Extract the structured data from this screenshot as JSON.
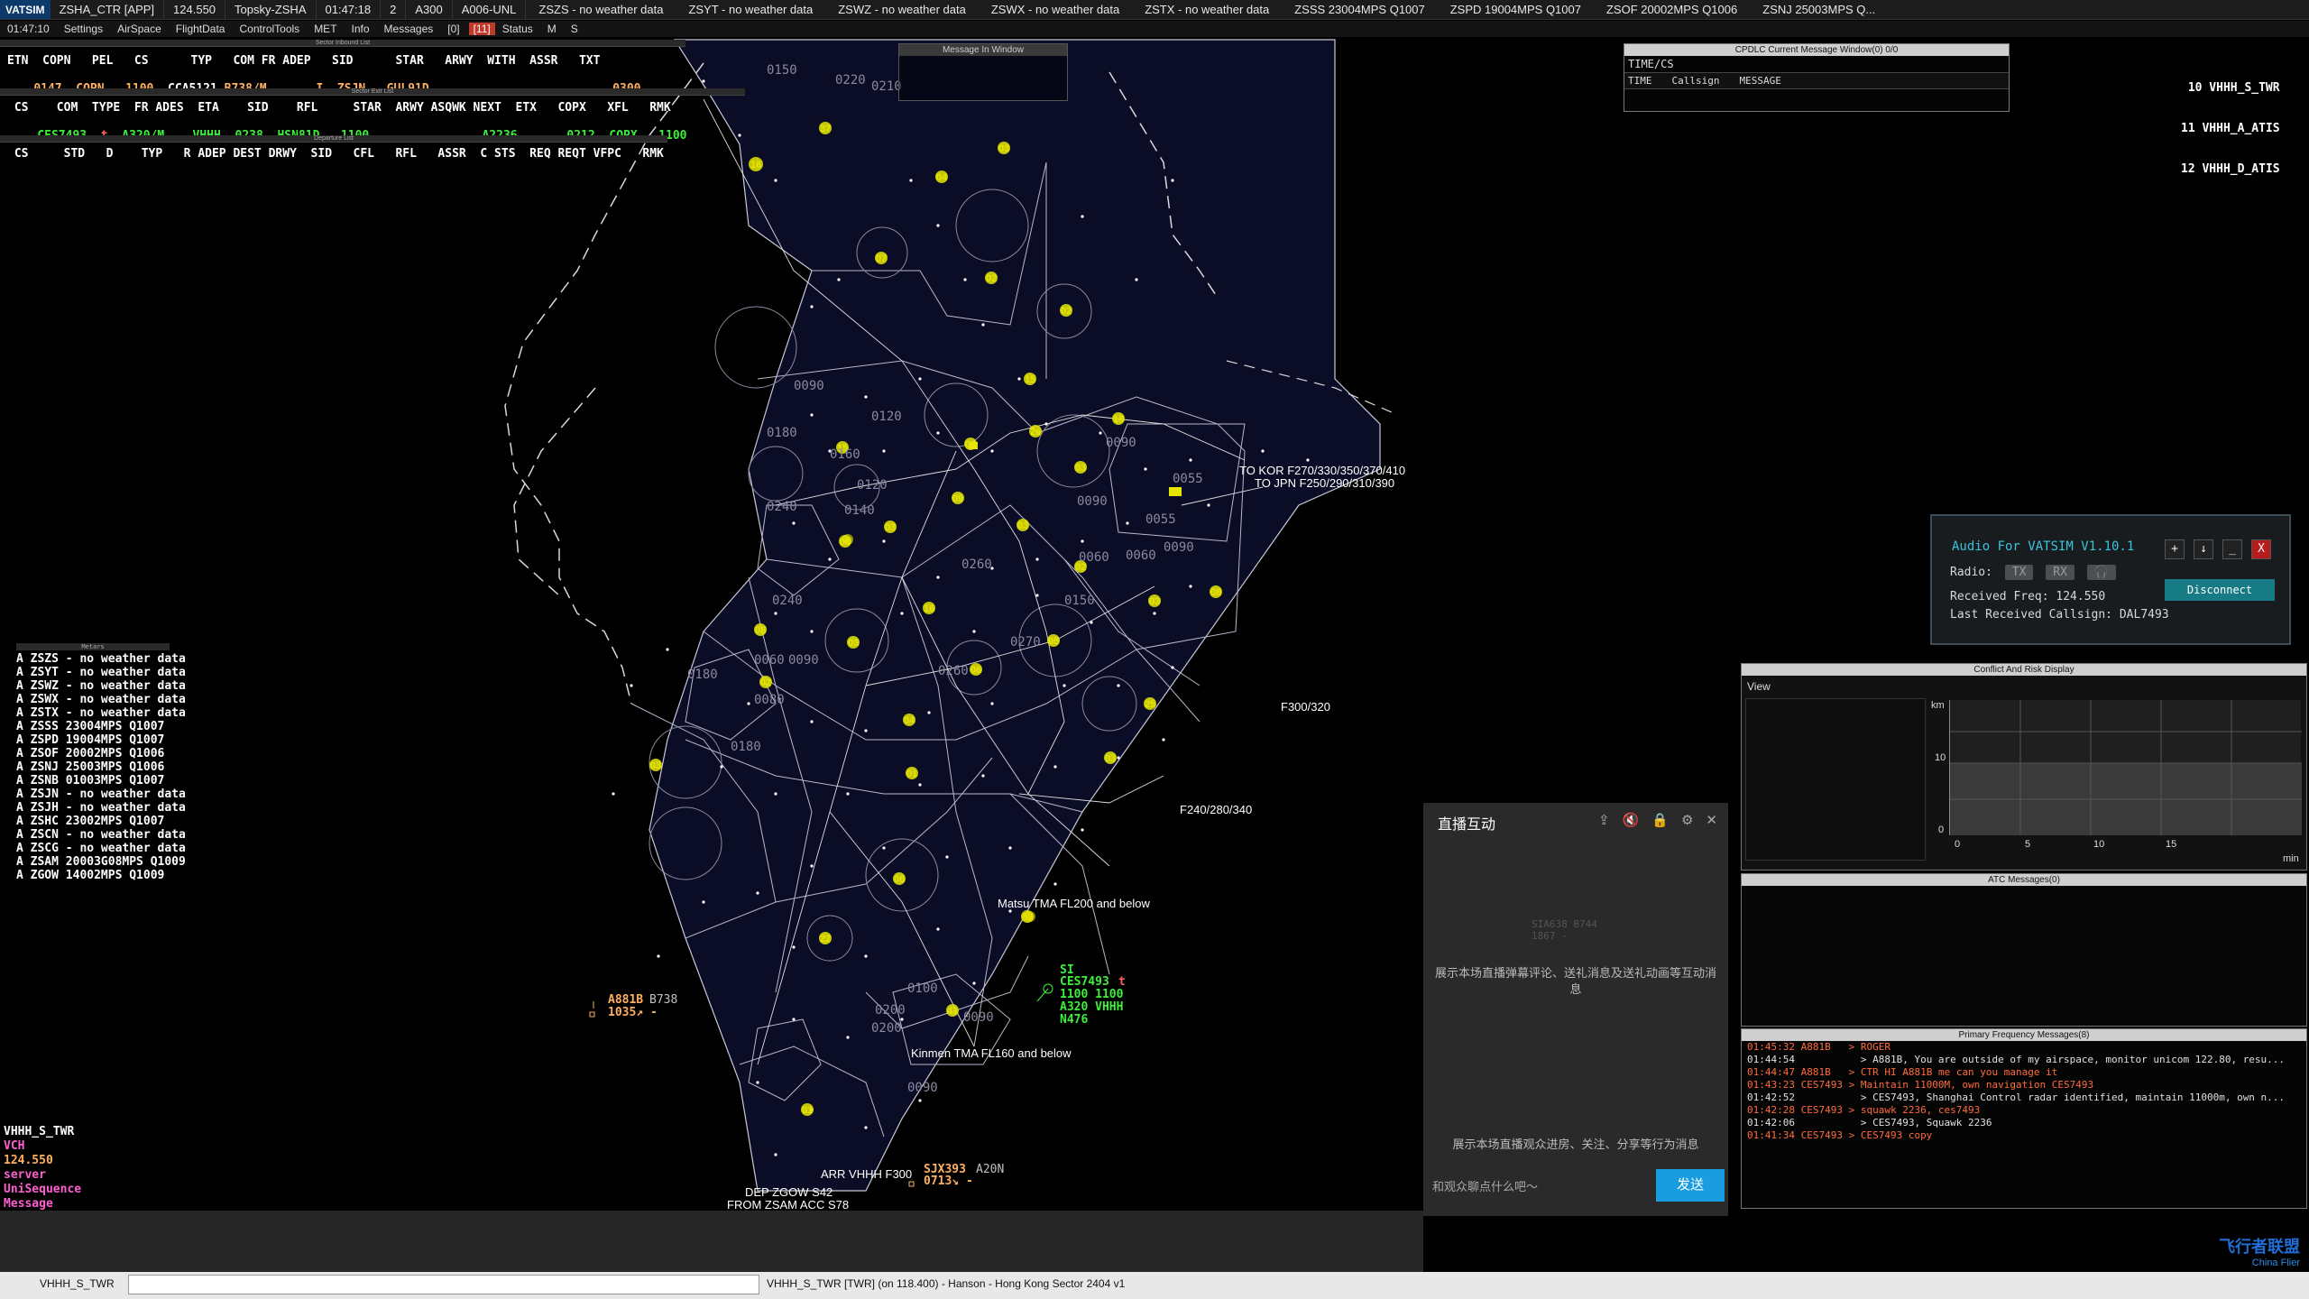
{
  "topbar": {
    "logo": "VATSIM",
    "position": "ZSHA_CTR [APP]",
    "frequency": "124.550",
    "open_sct": "Topsky-ZSHA",
    "time": "01:47:18",
    "min_count": "2",
    "aircraft": "A300",
    "alt_range": "A006-UNL",
    "weather": [
      "ZSZS - no weather data",
      "ZSYT - no weather data",
      "ZSWZ - no weather data",
      "ZSWX - no weather data",
      "ZSTX - no weather data",
      "ZSSS 23004MPS Q1007",
      "ZSPD 19004MPS Q1007",
      "ZSOF 20002MPS Q1006",
      "ZSNJ 25003MPS Q..."
    ]
  },
  "menubar": {
    "time": "01:47:10",
    "items": [
      "Settings",
      "AirSpace",
      "FlightData",
      "ControlTools",
      "MET",
      "Info",
      "Messages"
    ],
    "messages_count": "[0]",
    "warn": "[11]",
    "status": "Status",
    "m": "M",
    "s": "S"
  },
  "sector_inbound": {
    "title": "Sector Inbound List",
    "header": "ETN  COPN   PEL   CS      TYP   COM FR ADEP   SID      STAR   ARWY  WITH  ASSR   TXT",
    "rows": [
      {
        "etn": "0147",
        "copn": "COPN",
        "pel": "1100",
        "cs": "CCA5121",
        "typ": "B738/M",
        "fr": "I",
        "adep": "ZSJN",
        "sid": "GUL91D",
        "eta": "0300"
      }
    ]
  },
  "sector_exit": {
    "title": "Sector Exit List",
    "header": " CS    COM  TYPE  FR ADES  ETA    SID    RFL     STAR  ARWY ASQWK NEXT  ETX   COPX   XFL   RMK",
    "rows": [
      {
        "cs": "CES7493",
        "com": "t",
        "type": "A320/M",
        "ades": "VHHH",
        "eta": "0238",
        "sid": "HSN81D",
        "rfl": "1100",
        "asqwk": "A2236",
        "etx": "0212",
        "copx": "COPX",
        "xfl": "1100"
      }
    ]
  },
  "departure_list": {
    "title": "Departure List",
    "header": " CS     STD   D    TYP   R ADEP DEST DRWY  SID   CFL   RFL   ASSR  C STS  REQ REQT VFPC   RMK"
  },
  "metars": {
    "title": "Metars",
    "rows": [
      "A ZSZS - no weather data",
      "A ZSYT - no weather data",
      "A ZSWZ - no weather data",
      "A ZSWX - no weather data",
      "A ZSTX - no weather data",
      "A ZSSS 23004MPS Q1007",
      "A ZSPD 19004MPS Q1007",
      "A ZSOF 20002MPS Q1006",
      "A ZSNJ 25003MPS Q1006",
      "A ZSNB 01003MPS Q1007",
      "A ZSJN - no weather data",
      "A ZSJH - no weather data",
      "A ZSHC 23002MPS Q1007",
      "A ZSCN - no weather data",
      "A ZSCG - no weather data",
      "A ZSAM 20003G08MPS Q1009",
      "A ZGOW 14002MPS Q1009"
    ]
  },
  "lower_left": {
    "station": "VHHH_S_TWR",
    "vch": "VCH",
    "freq": "124.550",
    "server": "server",
    "unisequence": "UniSequence",
    "message": "Message"
  },
  "message_window": {
    "title": "Message In Window"
  },
  "cpdlc": {
    "title": "CPDLC Current Message Window(0) 0/0",
    "sub": "TIME/CS",
    "cols": [
      "TIME",
      "Callsign",
      "MESSAGE"
    ]
  },
  "atis": {
    "rows": [
      "10 VHHH_S_TWR",
      "11 VHHH_A_ATIS",
      "12 VHHH_D_ATIS"
    ]
  },
  "map": {
    "altitude_labels": [
      "0150",
      "0220",
      "0210",
      "0090",
      "0120",
      "0180",
      "0160",
      "0090",
      "0140",
      "0120",
      "0240",
      "0260",
      "0150",
      "0090",
      "0055",
      "0090",
      "0055",
      "0060",
      "0060",
      "0240",
      "0260",
      "0180",
      "0090",
      "0080",
      "0060",
      "0180",
      "0200",
      "0090",
      "0090",
      "0100",
      "0200",
      "0270"
    ],
    "route_labels": [
      "TO KOR F270/330/350/370/410",
      "TO JPN F250/290/310/390",
      "F300/320",
      "F240/280/340",
      "Matsu TMA FL200 and below",
      "Kinmen TMA FL160 and below",
      "ARR VHHH F300",
      "DEP ZGOW S42",
      "FROM ZSAM ACC S78"
    ],
    "fixes": [
      "16",
      "37",
      "03",
      "07",
      "02",
      "02",
      "04",
      "15",
      "18",
      "26",
      "06",
      "15",
      "03",
      "09",
      "03",
      "03",
      "08",
      "06",
      "02",
      "03",
      "16",
      "08",
      "03",
      "05",
      "06",
      "02",
      "25",
      "04",
      "03",
      "03",
      "01",
      "06",
      "03",
      "22",
      "01",
      "41",
      "03"
    ],
    "tags": [
      {
        "cs": "A881B",
        "type": "B738",
        "alt": "1035↗ -"
      },
      {
        "cs": "CES7493",
        "code": "t",
        "line2": "1100 1100",
        "line3": "A320 VHHH",
        "line4": "N476",
        "label": "SI"
      },
      {
        "cs": "SJX393",
        "type": "A20N",
        "alt": "0713↘ -"
      }
    ],
    "faint_tag": [
      "SIA638 B744",
      "1867 -"
    ]
  },
  "audio": {
    "title": "Audio For VATSIM V1.10.1",
    "radio_label": "Radio:",
    "tx": "TX",
    "rx": "RX",
    "headset_icon": "headset-icon",
    "received_freq": "Received Freq: 124.550",
    "last_callsign": "Last Received Callsign: DAL7493",
    "disconnect": "Disconnect",
    "btn_plus": "+",
    "btn_down": "↓",
    "btn_min": "_",
    "btn_close": "X"
  },
  "conflict": {
    "title": "Conflict And Risk Display",
    "view": "View",
    "y_unit": "km",
    "y_ticks": [
      "10",
      "0"
    ],
    "x_ticks": [
      "0",
      "5",
      "10",
      "15"
    ],
    "x_unit": "min"
  },
  "atc_messages": {
    "title": "ATC Messages(0)"
  },
  "primary_freq": {
    "title": "Primary Frequency Messages(8)",
    "rows": [
      {
        "time": "01:45:32",
        "cs": "A881B",
        "msg": "> ROGER",
        "color": "#ff6a3c"
      },
      {
        "time": "01:44:54",
        "cs": "",
        "msg": "> A881B, You are outside of my airspace, monitor unicom 122.80, resu...",
        "color": "#e0e0e0"
      },
      {
        "time": "01:44:47",
        "cs": "A881B",
        "msg": "> CTR HI A881B me can you manage it",
        "color": "#ff6a3c"
      },
      {
        "time": "01:43:23",
        "cs": "CES7493",
        "msg": "> Maintain 11000M, own navigation CES7493",
        "color": "#ff6a3c"
      },
      {
        "time": "01:42:52",
        "cs": "",
        "msg": "> CES7493, Shanghai Control radar identified, maintain 11000m, own n...",
        "color": "#e0e0e0"
      },
      {
        "time": "01:42:28",
        "cs": "CES7493",
        "msg": "> squawk 2236, ces7493",
        "color": "#ff6a3c"
      },
      {
        "time": "01:42:06",
        "cs": "",
        "msg": "> CES7493, Squawk 2236",
        "color": "#e0e0e0"
      },
      {
        "time": "01:41:34",
        "cs": "CES7493",
        "msg": "> CES7493 copy",
        "color": "#ff6a3c"
      }
    ]
  },
  "live": {
    "title": "直播互动",
    "desc1": "展示本场直播弹幕评论、送礼消息及送礼动画等互动消息",
    "desc2": "展示本场直播观众进房、关注、分享等行为消息",
    "input_placeholder": "和观众聊点什么吧～",
    "send": "发送"
  },
  "cmdline": {
    "left": "VHHH_S_TWR",
    "mid": "VHHH_S_TWR [TWR] (on 118.400) - Hanson - Hong Kong Sector 2404 v1"
  },
  "brand": {
    "name": "飞行者联盟",
    "sub": "China Flier"
  },
  "colors": {
    "map_bg": "#0b0d26",
    "fix": "#e6e600",
    "tag_green": "#3cf03c",
    "tag_orange": "#ffb060",
    "accent_cyan": "#3ac4dc"
  }
}
